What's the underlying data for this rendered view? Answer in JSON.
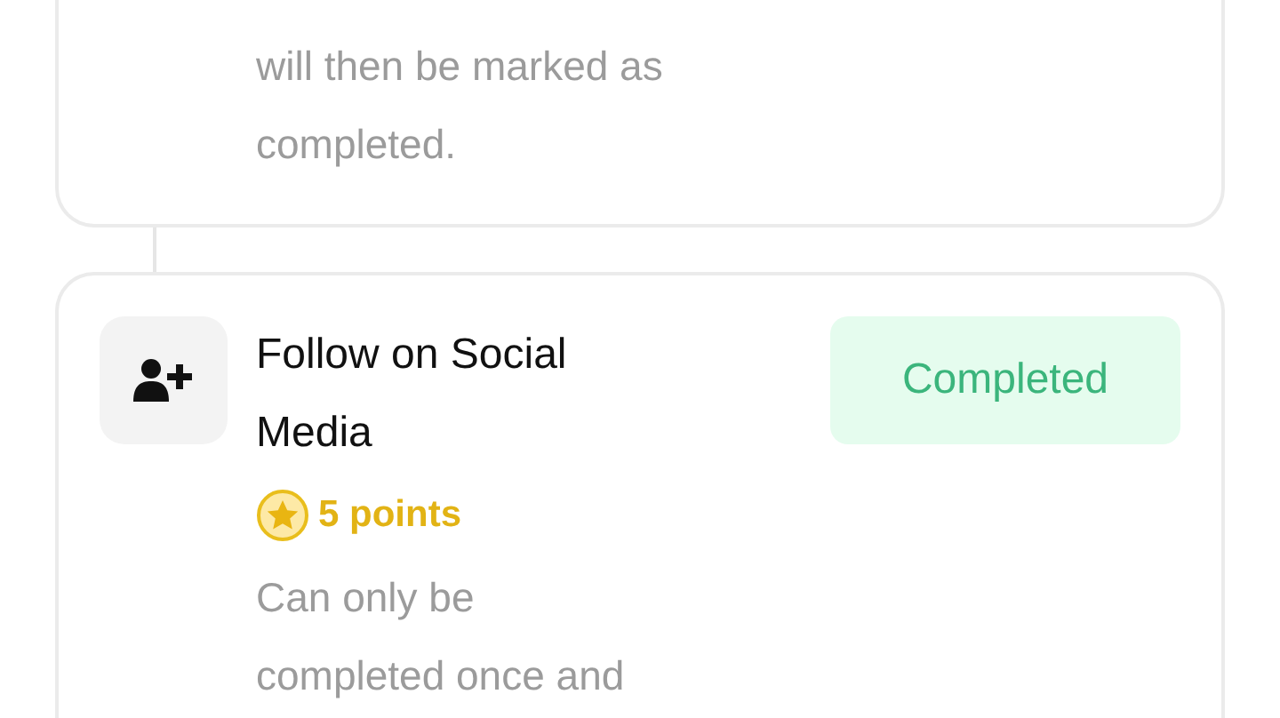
{
  "tasks": [
    {
      "description": "will then be marked as completed."
    },
    {
      "title": "Follow on Social Media",
      "points": "5 points",
      "status": "Completed",
      "completed": true,
      "description": "Can only be completed once and"
    }
  ]
}
